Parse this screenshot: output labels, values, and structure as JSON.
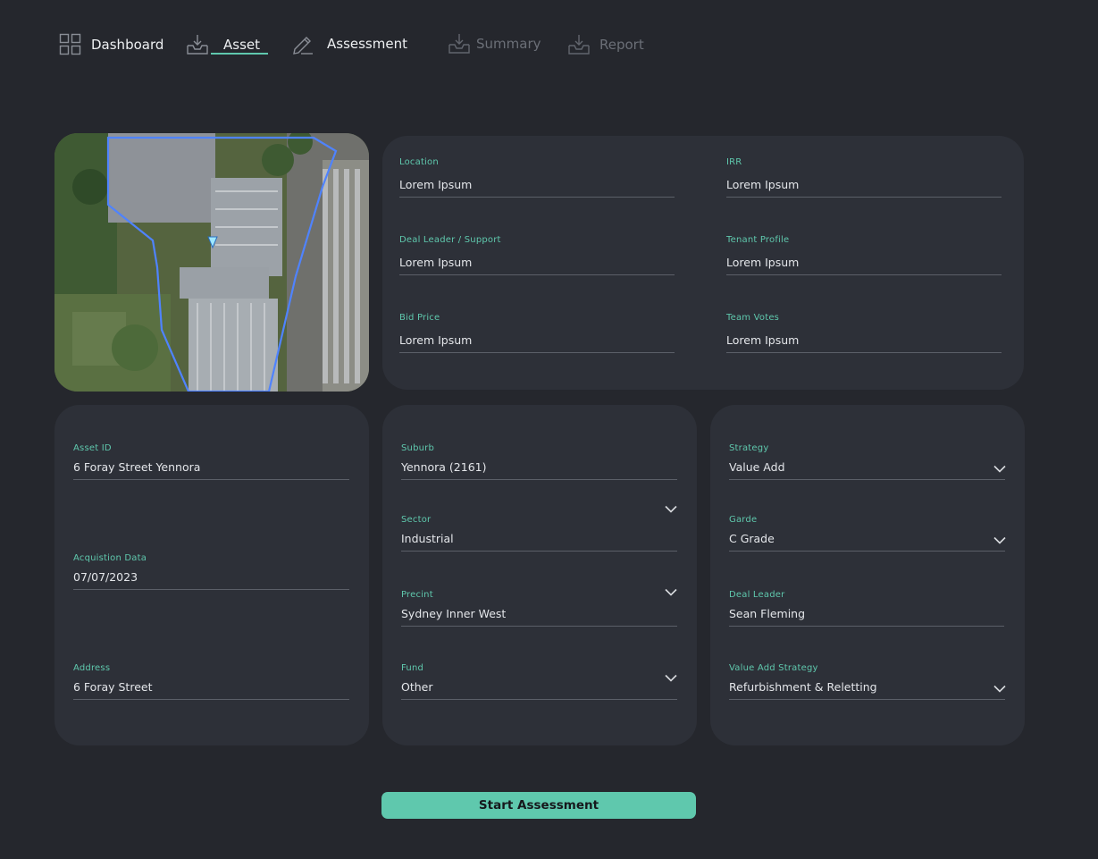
{
  "nav": {
    "items": [
      {
        "label": "Dashboard",
        "icon": "dashboard-grid-icon"
      },
      {
        "label": "Asset",
        "icon": "download-tray-icon"
      },
      {
        "label": "Assessment",
        "icon": "pencil-icon"
      },
      {
        "label": "Summary",
        "icon": "download-tray-icon"
      },
      {
        "label": "Report",
        "icon": "download-tray-icon"
      }
    ],
    "active": "Asset"
  },
  "overview": {
    "location": {
      "label": "Location",
      "value": "Lorem Ipsum"
    },
    "irr": {
      "label": "IRR",
      "value": "Lorem Ipsum"
    },
    "deal_leader_support": {
      "label": "Deal Leader / Support",
      "value": "Lorem Ipsum"
    },
    "tenant_profile": {
      "label": "Tenant Profile",
      "value": "Lorem Ipsum"
    },
    "bid_price": {
      "label": "Bid Price",
      "value": "Lorem Ipsum"
    },
    "team_votes": {
      "label": "Team Votes",
      "value": "Lorem Ipsum"
    }
  },
  "asset": {
    "asset_id": {
      "label": "Asset ID",
      "value": "6 Foray Street Yennora"
    },
    "acquisition": {
      "label": "Acquistion Data",
      "value": "07/07/2023"
    },
    "address": {
      "label": "Address",
      "value": "6 Foray Street"
    }
  },
  "location": {
    "suburb": {
      "label": "Suburb",
      "value": "Yennora  (2161)"
    },
    "sector": {
      "label": "Sector",
      "value": "Industrial"
    },
    "precint": {
      "label": "Precint",
      "value": "Sydney Inner West"
    },
    "fund": {
      "label": "Fund",
      "value": "Other"
    }
  },
  "strategy": {
    "strategy": {
      "label": "Strategy",
      "value": "Value Add"
    },
    "grade": {
      "label": "Garde",
      "value": "C Grade"
    },
    "deal_leader": {
      "label": "Deal Leader",
      "value": "Sean Fleming"
    },
    "value_add_strategy": {
      "label": "Value Add Strategy",
      "value": "Refurbishment & Reletting"
    }
  },
  "actions": {
    "start_label": "Start Assessment"
  },
  "colors": {
    "accent": "#5fc8ad",
    "background": "#25272d",
    "panel": "#2d3038"
  }
}
